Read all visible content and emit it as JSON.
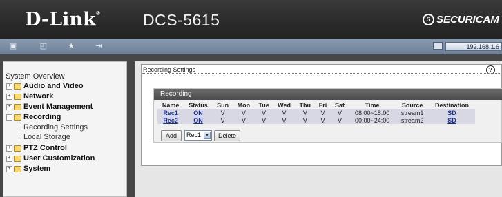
{
  "header": {
    "logo": "D-Link",
    "logo_mark": "®",
    "model": "DCS-5615",
    "brand": "SECURICAM",
    "brand_mark": "S"
  },
  "toolbar": {
    "icons": [
      "camera-icon",
      "playback-icon",
      "favorite-icon",
      "logout-icon"
    ],
    "ip": "192.168.1.6"
  },
  "sidebar": {
    "overview": "System Overview",
    "items": [
      {
        "label": "Audio and Video",
        "expander": "+"
      },
      {
        "label": "Network",
        "expander": "+"
      },
      {
        "label": "Event Management",
        "expander": "+"
      },
      {
        "label": "Recording",
        "expander": "-"
      },
      {
        "label": "PTZ Control",
        "expander": "+"
      },
      {
        "label": "User Customization",
        "expander": "+"
      },
      {
        "label": "System",
        "expander": "+"
      }
    ],
    "recording_children": [
      "Recording Settings",
      "Local Storage"
    ]
  },
  "panel": {
    "title": "Recording Settings",
    "help": "?"
  },
  "recording": {
    "title": "Recording",
    "columns": [
      "Name",
      "Status",
      "Sun",
      "Mon",
      "Tue",
      "Wed",
      "Thu",
      "Fri",
      "Sat",
      "Time",
      "Source",
      "Destination"
    ],
    "rows": [
      [
        "Rec1",
        "ON",
        "V",
        "V",
        "V",
        "V",
        "V",
        "V",
        "V",
        "08:00~18:00",
        "stream1",
        "SD"
      ],
      [
        "Rec2",
        "ON",
        "V",
        "V",
        "V",
        "V",
        "V",
        "V",
        "V",
        "00:00~24:00",
        "stream2",
        "SD"
      ]
    ],
    "add_label": "Add",
    "select_value": "Rec1",
    "select_arrow": "▾",
    "delete_label": "Delete"
  }
}
